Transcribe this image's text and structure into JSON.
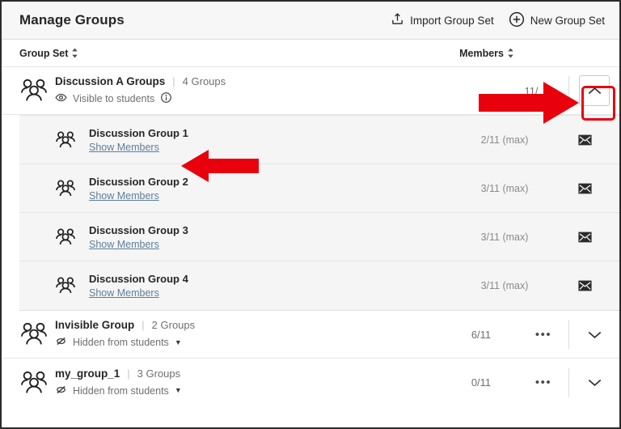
{
  "header": {
    "title": "Manage Groups",
    "actions": [
      {
        "label": "Import Group Set",
        "icon": "upload-icon"
      },
      {
        "label": "New Group Set",
        "icon": "plus-circle-icon"
      }
    ]
  },
  "columns": {
    "group_set": "Group Set",
    "members": "Members"
  },
  "group_sets": [
    {
      "name": "Discussion A Groups",
      "separator": "|",
      "group_count": "4 Groups",
      "visibility": "Visible to students",
      "visibility_icon": "eye-icon",
      "has_info_icon": true,
      "has_visibility_caret": false,
      "members": "11/",
      "expanded": true,
      "show_dots": false,
      "chevron": "chevron-up-icon",
      "groups": [
        {
          "name": "Discussion Group 1",
          "link": "Show Members",
          "members": "2/11 (max)",
          "mail_icon": "mail-icon"
        },
        {
          "name": "Discussion Group 2",
          "link": "Show Members",
          "members": "3/11 (max)",
          "mail_icon": "mail-icon"
        },
        {
          "name": "Discussion Group 3",
          "link": "Show Members",
          "members": "3/11 (max)",
          "mail_icon": "mail-icon"
        },
        {
          "name": "Discussion Group 4",
          "link": "Show Members",
          "members": "3/11 (max)",
          "mail_icon": "mail-icon"
        }
      ]
    },
    {
      "name": "Invisible Group",
      "separator": "|",
      "group_count": "2 Groups",
      "visibility": "Hidden from students",
      "visibility_icon": "eye-slash-icon",
      "has_info_icon": false,
      "has_visibility_caret": true,
      "members": "6/11",
      "expanded": false,
      "show_dots": true,
      "dots": "•••",
      "chevron": "chevron-down-icon",
      "groups": []
    },
    {
      "name": "my_group_1",
      "separator": "|",
      "group_count": "3 Groups",
      "visibility": "Hidden from students",
      "visibility_icon": "eye-slash-icon",
      "has_info_icon": false,
      "has_visibility_caret": true,
      "members": "0/11",
      "expanded": false,
      "show_dots": true,
      "dots": "•••",
      "chevron": "chevron-down-icon",
      "groups": []
    }
  ],
  "annotations": {
    "arrow_color": "#e8000d",
    "highlight_color": "#e8000d",
    "arrow_to_collapse_button": "arrow-right-annotation",
    "arrow_to_show_members": "arrow-left-annotation",
    "highlight_collapse_button": "box-highlight-annotation"
  }
}
